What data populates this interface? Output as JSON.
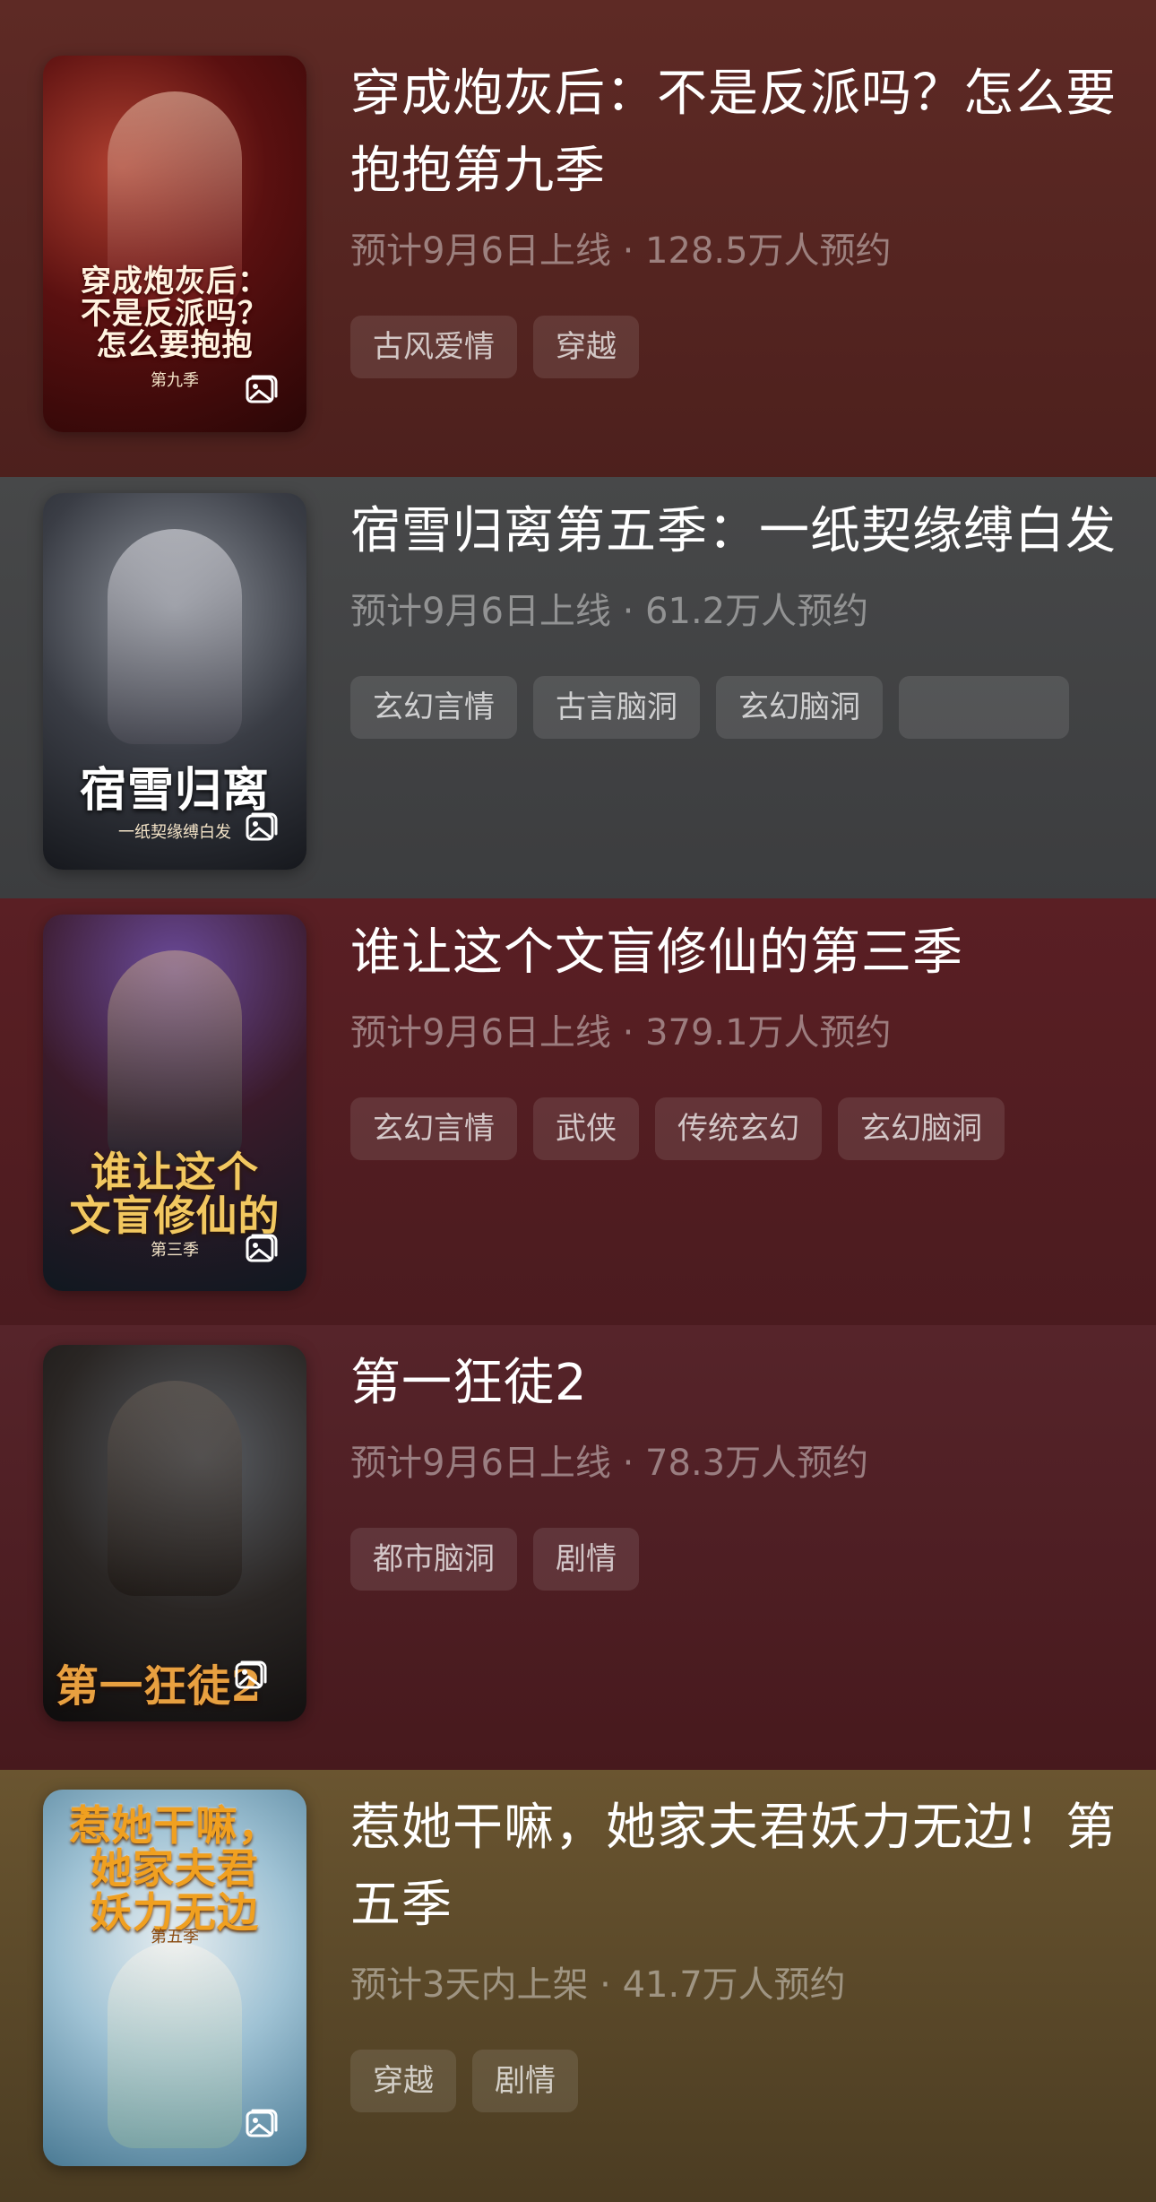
{
  "items": [
    {
      "title": "穿成炮灰后：不是反派吗？怎么要抱抱第九季",
      "meta": "预计9月6日上线 · 128.5万人预约",
      "tags": [
        "古风爱情",
        "穿越"
      ],
      "cover_title": "穿成炮灰后：\n不是反派吗？\n怎么要抱抱",
      "cover_sub": "第九季",
      "cover_icon": "image-icon"
    },
    {
      "title": "宿雪归离第五季：一纸契缘缚白发",
      "meta": "预计9月6日上线 · 61.2万人预约",
      "tags": [
        "玄幻言情",
        "古言脑洞",
        "玄幻脑洞",
        ""
      ],
      "cover_title": "宿雪归离",
      "cover_sub": "一纸契缘缚白发",
      "cover_icon": "image-icon"
    },
    {
      "title": "谁让这个文盲修仙的第三季",
      "meta": "预计9月6日上线 · 379.1万人预约",
      "tags": [
        "玄幻言情",
        "武侠",
        "传统玄幻",
        "玄幻脑洞"
      ],
      "cover_title": "谁让这个\n文盲修仙的",
      "cover_sub": "第三季",
      "cover_icon": "image-icon"
    },
    {
      "title": "第一狂徒2",
      "meta": "预计9月6日上线 · 78.3万人预约",
      "tags": [
        "都市脑洞",
        "剧情"
      ],
      "cover_title": "第一狂徒2",
      "cover_sub": "",
      "cover_icon": "image-icon"
    },
    {
      "title": "惹她干嘛，她家夫君妖力无边！第五季",
      "meta": "预计3天内上架 · 41.7万人预约",
      "tags": [
        "穿越",
        "剧情"
      ],
      "cover_title": "惹她干嘛，\n她家夫君\n妖力无边",
      "cover_sub": "第五季",
      "cover_icon": "image-icon"
    }
  ]
}
